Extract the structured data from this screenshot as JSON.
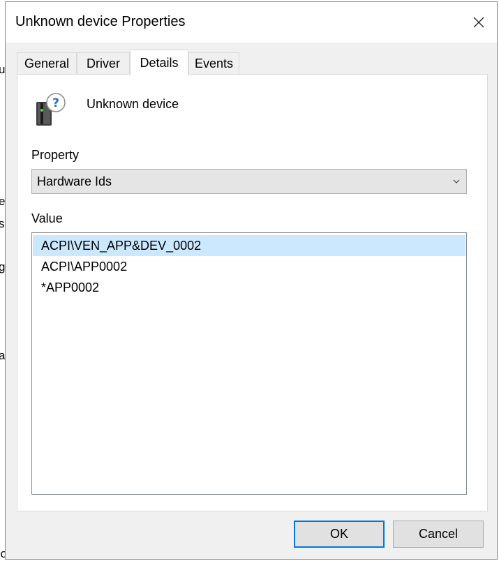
{
  "background": {
    "fragments": [
      "u",
      "es",
      "s",
      "g",
      "a"
    ],
    "bottom_text": "controllers"
  },
  "dialog": {
    "title": "Unknown device Properties",
    "close_icon": "close-icon"
  },
  "tabs": [
    {
      "label": "General",
      "active": false
    },
    {
      "label": "Driver",
      "active": false
    },
    {
      "label": "Details",
      "active": true
    },
    {
      "label": "Events",
      "active": false
    }
  ],
  "device": {
    "name": "Unknown device",
    "icon": "unknown-device-icon"
  },
  "property": {
    "label": "Property",
    "selected": "Hardware Ids"
  },
  "value": {
    "label": "Value",
    "items": [
      "ACPI\\VEN_APP&DEV_0002",
      "ACPI\\APP0002",
      "*APP0002"
    ],
    "selected_index": 0
  },
  "buttons": {
    "ok": "OK",
    "cancel": "Cancel"
  },
  "colors": {
    "selection": "#cce8ff",
    "accent": "#0078d7",
    "dialog_bg": "#f0f0f0"
  }
}
